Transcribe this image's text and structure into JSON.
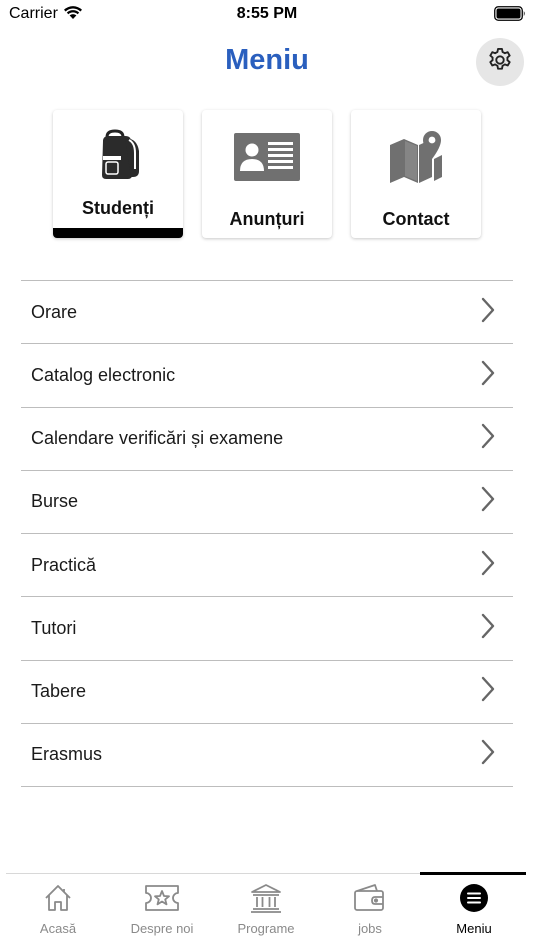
{
  "status_bar": {
    "carrier": "Carrier",
    "time": "8:55 PM"
  },
  "header": {
    "title": "Meniu"
  },
  "cards": [
    {
      "label": "Studenți",
      "icon": "backpack-icon",
      "active": true
    },
    {
      "label": "Anunțuri",
      "icon": "id-card-icon",
      "active": false
    },
    {
      "label": "Contact",
      "icon": "map-pin-icon",
      "active": false
    }
  ],
  "menu": {
    "items": [
      {
        "label": "Orare"
      },
      {
        "label": "Catalog electronic"
      },
      {
        "label": "Calendare verificări și examene"
      },
      {
        "label": "Burse"
      },
      {
        "label": "Practică"
      },
      {
        "label": "Tutori"
      },
      {
        "label": "Tabere"
      },
      {
        "label": "Erasmus"
      }
    ]
  },
  "tab_bar": {
    "tabs": [
      {
        "label": "Acasă",
        "icon": "home-icon"
      },
      {
        "label": "Despre noi",
        "icon": "ticket-star-icon"
      },
      {
        "label": "Programe",
        "icon": "institution-icon"
      },
      {
        "label": "jobs",
        "icon": "wallet-icon"
      },
      {
        "label": "Meniu",
        "icon": "menu-icon",
        "active": true
      }
    ]
  },
  "colors": {
    "title": "#2a5fbe",
    "icon_gray": "#707070",
    "divider": "#bdbdbd",
    "tab_inactive": "#8a8a8a"
  }
}
